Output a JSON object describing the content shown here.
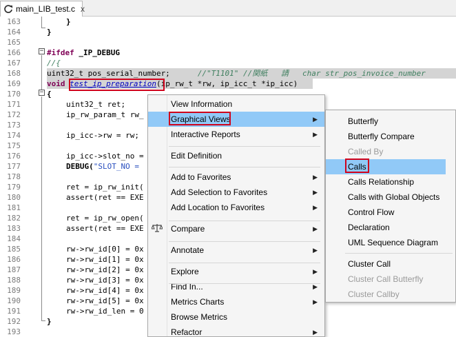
{
  "tab": {
    "title": "main_LIB_test.c",
    "close": "x"
  },
  "lines": [
    {
      "n": "163",
      "t": "}"
    },
    {
      "n": "164",
      "t": "}"
    },
    {
      "n": "165",
      "t": ""
    },
    {
      "n": "166",
      "t": "#ifdef _IP_DEBUG"
    },
    {
      "n": "167",
      "t": "//{"
    },
    {
      "n": "168",
      "t": "uint32_t pos_serial_number;",
      "c": "//\"T1101\" //関紙   請   char str_pos_invoice_number"
    },
    {
      "n": "169",
      "t": "void",
      "fn": "test_ip_preparation",
      "rest": "(ip_rw_t *rw, ip_icc_t *ip_icc)"
    },
    {
      "n": "170",
      "t": "{"
    },
    {
      "n": "171",
      "t": "uint32_t ret;"
    },
    {
      "n": "172",
      "t": "ip_rw_param_t rw_"
    },
    {
      "n": "173",
      "t": ""
    },
    {
      "n": "174",
      "t": "ip_icc->rw = rw;"
    },
    {
      "n": "175",
      "t": ""
    },
    {
      "n": "176",
      "t": "ip_icc->slot_no ="
    },
    {
      "n": "177",
      "t": "DEBUG(\"SLOT_NO ="
    },
    {
      "n": "178",
      "t": ""
    },
    {
      "n": "179",
      "t": "ret = ip_rw_init("
    },
    {
      "n": "180",
      "t": "assert(ret == EXE"
    },
    {
      "n": "181",
      "t": ""
    },
    {
      "n": "182",
      "t": "ret = ip_rw_open("
    },
    {
      "n": "183",
      "t": "assert(ret == EXE"
    },
    {
      "n": "184",
      "t": ""
    },
    {
      "n": "185",
      "t": "rw->rw_id[0] = 0x"
    },
    {
      "n": "186",
      "t": "rw->rw_id[1] = 0x"
    },
    {
      "n": "187",
      "t": "rw->rw_id[2] = 0x"
    },
    {
      "n": "188",
      "t": "rw->rw_id[3] = 0x"
    },
    {
      "n": "189",
      "t": "rw->rw_id[4] = 0x"
    },
    {
      "n": "190",
      "t": "rw->rw_id[5] = 0x"
    },
    {
      "n": "191",
      "t": "rw->rw_id_len = 0"
    },
    {
      "n": "192",
      "t": "}"
    },
    {
      "n": "193",
      "t": ""
    }
  ],
  "menu": {
    "items": [
      {
        "label": "View Information",
        "arrow": ""
      },
      {
        "label": "Graphical Views",
        "arrow": "▶"
      },
      {
        "label": "Interactive Reports",
        "arrow": "▶"
      },
      {
        "label": "Edit Definition",
        "arrow": ""
      },
      {
        "label": "Add to Favorites",
        "arrow": "▶"
      },
      {
        "label": "Add Selection to Favorites",
        "arrow": "▶"
      },
      {
        "label": "Add Location to Favorites",
        "arrow": "▶"
      },
      {
        "label": "Compare",
        "arrow": "▶"
      },
      {
        "label": "Annotate",
        "arrow": "▶"
      },
      {
        "label": "Explore",
        "arrow": "▶"
      },
      {
        "label": "Find In...",
        "arrow": "▶"
      },
      {
        "label": "Metrics Charts",
        "arrow": "▶"
      },
      {
        "label": "Browse Metrics",
        "arrow": ""
      },
      {
        "label": "Refactor",
        "arrow": "▶"
      }
    ]
  },
  "submenu": {
    "items": [
      {
        "label": "Butterfly"
      },
      {
        "label": "Butterfly Compare"
      },
      {
        "label": "Called By"
      },
      {
        "label": "Calls"
      },
      {
        "label": "Calls Relationship"
      },
      {
        "label": "Calls with Global Objects"
      },
      {
        "label": "Control Flow"
      },
      {
        "label": "Declaration"
      },
      {
        "label": "UML Sequence Diagram"
      },
      {
        "label": "Cluster Call"
      },
      {
        "label": "Cluster Call Butterfly"
      },
      {
        "label": "Cluster Callby"
      }
    ]
  },
  "colors": {
    "highlight": "#91c9f7",
    "annotation_box": "#d0021b",
    "keyword": "#7f0055",
    "comment": "#3f7f5f"
  },
  "icons": [
    "refresh-icon",
    "close-icon",
    "scale-icon",
    "submenu-arrow-icon"
  ]
}
